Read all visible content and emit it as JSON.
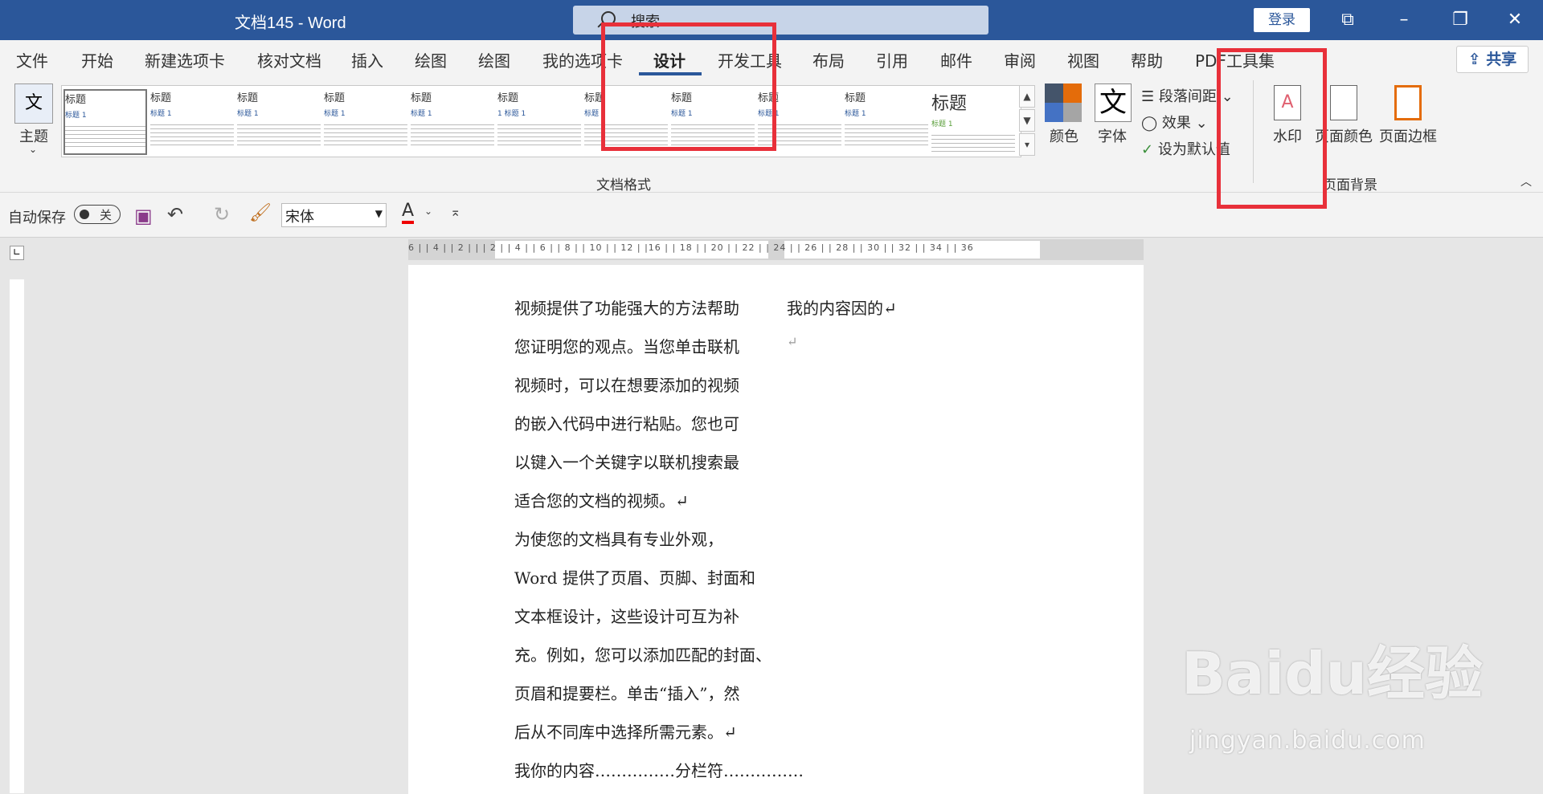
{
  "titlebar": {
    "title": "文档145  -  Word",
    "search_placeholder": "搜索",
    "login": "登录"
  },
  "tabs": [
    "文件",
    "开始",
    "新建选项卡",
    "核对文档",
    "插入",
    "绘图",
    "绘图",
    "我的选项卡",
    "设计",
    "开发工具",
    "布局",
    "引用",
    "邮件",
    "审阅",
    "视图",
    "帮助",
    "PDF工具集"
  ],
  "share": "共享",
  "ribbon": {
    "theme": "主题",
    "gallery": [
      {
        "t1": "标题",
        "t2": "标题 1"
      },
      {
        "t1": "标题",
        "t2": "标题 1"
      },
      {
        "t1": "标题",
        "t2": "标题 1"
      },
      {
        "t1": "标题",
        "t2": "标题 1"
      },
      {
        "t1": "标题",
        "t2": "标题 1"
      },
      {
        "t1": "标题",
        "t2": "1 标题 1"
      },
      {
        "t1": "标题",
        "t2": "标题 1"
      },
      {
        "t1": "标题",
        "t2": "标题 1"
      },
      {
        "t1": "标题",
        "t2": "标题 1"
      },
      {
        "t1": "标题",
        "t2": "标题 1"
      },
      {
        "t1": "标题",
        "t2": "标题 1"
      }
    ],
    "group_doc_format": "文档格式",
    "colors": "颜色",
    "fonts": "字体",
    "para_spacing": "段落间距",
    "effects": "效果",
    "set_default": "设为默认值",
    "watermark": "水印",
    "page_color": "页面颜色",
    "page_border": "页面边框",
    "group_page_bg": "页面背景"
  },
  "qat": {
    "autosave": "自动保存",
    "toggle_state": "关",
    "font": "宋体"
  },
  "ruler": {
    "top": "6 |  | 4 |  | 2 |  |  | 2 |  | 4 |  | 6 |  | 8 |  | 10 |  | 12 |      |16 |  | 18 |  | 20 |  | 22 |  | 24 |  | 26 |  | 28 |  | 30 |  | 32 |  | 34 |  | 36"
  },
  "document": {
    "col1": [
      "视频提供了功能强大的方法帮助",
      "您证明您的观点。当您单击联机",
      "视频时，可以在想要添加的视频",
      "的嵌入代码中进行粘贴。您也可",
      "以键入一个关键字以联机搜索最",
      "适合您的文档的视频。↵",
      "为使您的文档具有专业外观，",
      "Word 提供了页眉、页脚、封面和",
      "文本框设计，这些设计可互为补",
      "充。例如，您可以添加匹配的封面、",
      "页眉和提要栏。单击“插入”，然",
      "后从不同库中选择所需元素。↵",
      "我你的内容……………分栏符……………"
    ],
    "col2": [
      "我的内容因的↵",
      "↵"
    ]
  },
  "watermark_logo": {
    "text": "Baidu经验",
    "url": "jingyan.baidu.com"
  }
}
